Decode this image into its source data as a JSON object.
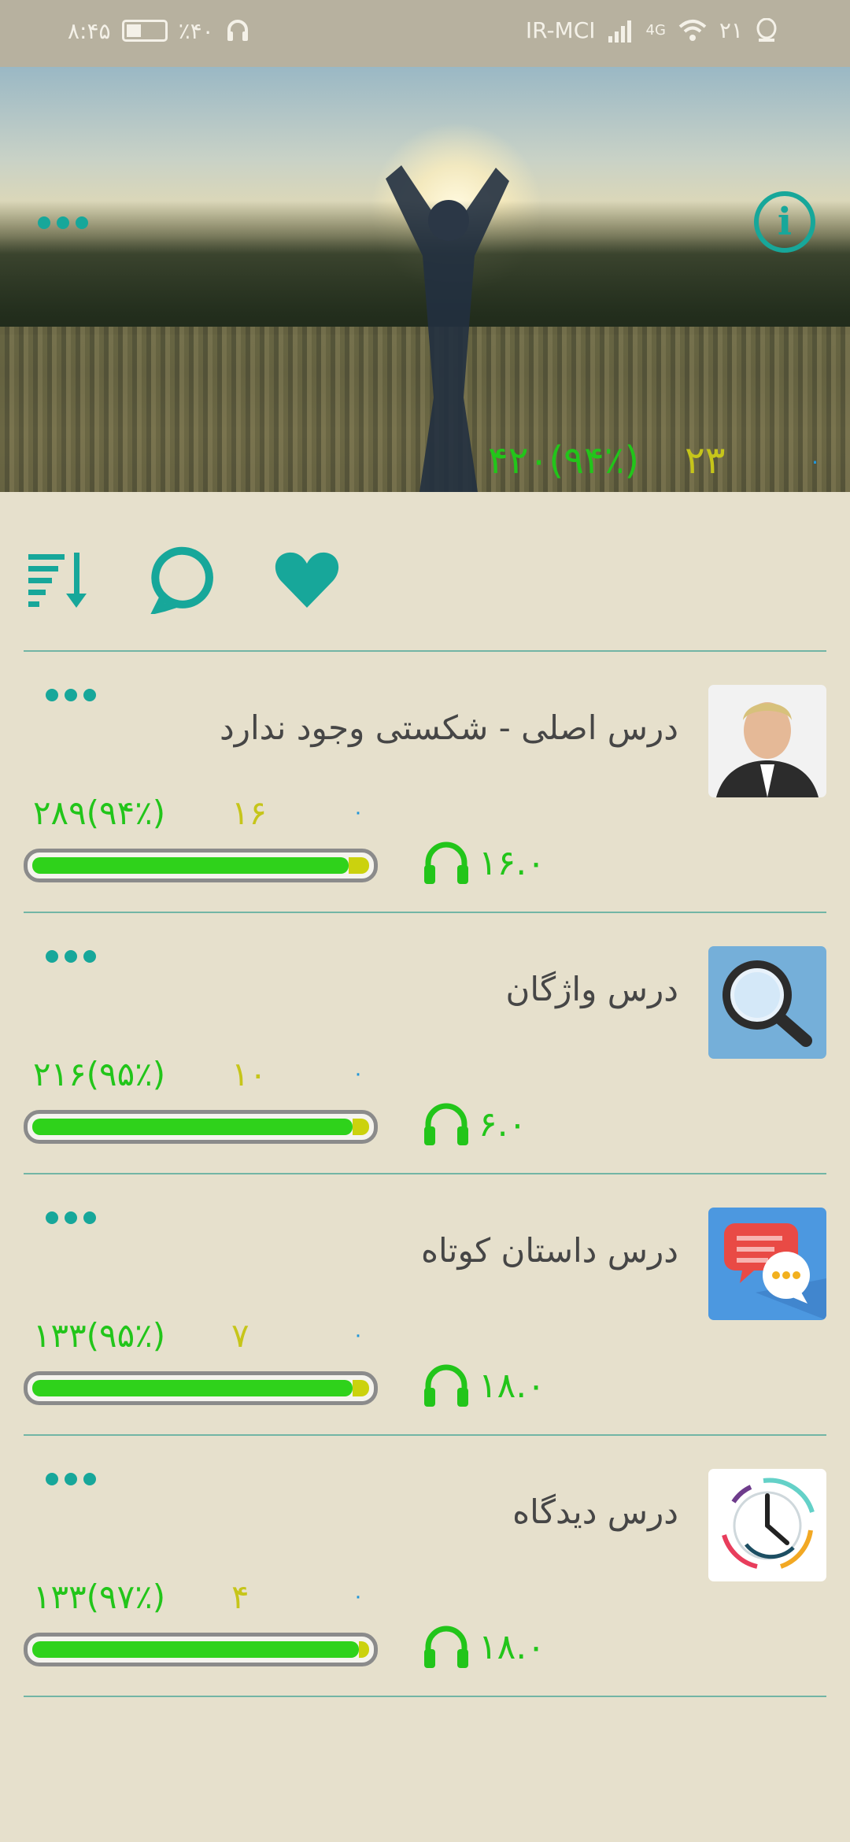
{
  "status_bar": {
    "time": "۸:۴۵",
    "battery": "٪۴۰",
    "notification_count": "۲۱",
    "network": "IR-MCI",
    "network_type": "4G"
  },
  "hero": {
    "stats": {
      "score": "۴۲۰(۹۴٪)",
      "count": "۲۳",
      "other": "۰"
    },
    "progress_fraction": 0.94
  },
  "toolbar": {
    "icons": [
      "sort-icon",
      "comment-icon",
      "heart-icon"
    ]
  },
  "lessons": [
    {
      "title": "درس اصلی - شکستی وجود ندارد",
      "score": "۲۸۹(۹۴٪)",
      "count": "۱۶",
      "other": "۰",
      "audio": "۱۶.۰",
      "progress_fraction": 0.94,
      "thumbnail": "portrait"
    },
    {
      "title": "درس واژگان",
      "score": "۲۱۶(۹۵٪)",
      "count": "۱۰",
      "other": "۰",
      "audio": "۶.۰",
      "progress_fraction": 0.95,
      "thumbnail": "magnifier-icon"
    },
    {
      "title": "درس داستان کوتاه",
      "score": "۱۳۳(۹۵٪)",
      "count": "۷",
      "other": "۰",
      "audio": "۱۸.۰",
      "progress_fraction": 0.95,
      "thumbnail": "chat-icon"
    },
    {
      "title": "درس دیدگاه",
      "score": "۱۳۳(۹۷٪)",
      "count": "۴",
      "other": "۰",
      "audio": "۱۸.۰",
      "progress_fraction": 0.97,
      "thumbnail": "clock-icon"
    }
  ],
  "colors": {
    "accent": "#17a79a",
    "green": "#22c51a",
    "yellow": "#c6c51a",
    "blue": "#2196d8",
    "background": "#e6e0cc"
  }
}
